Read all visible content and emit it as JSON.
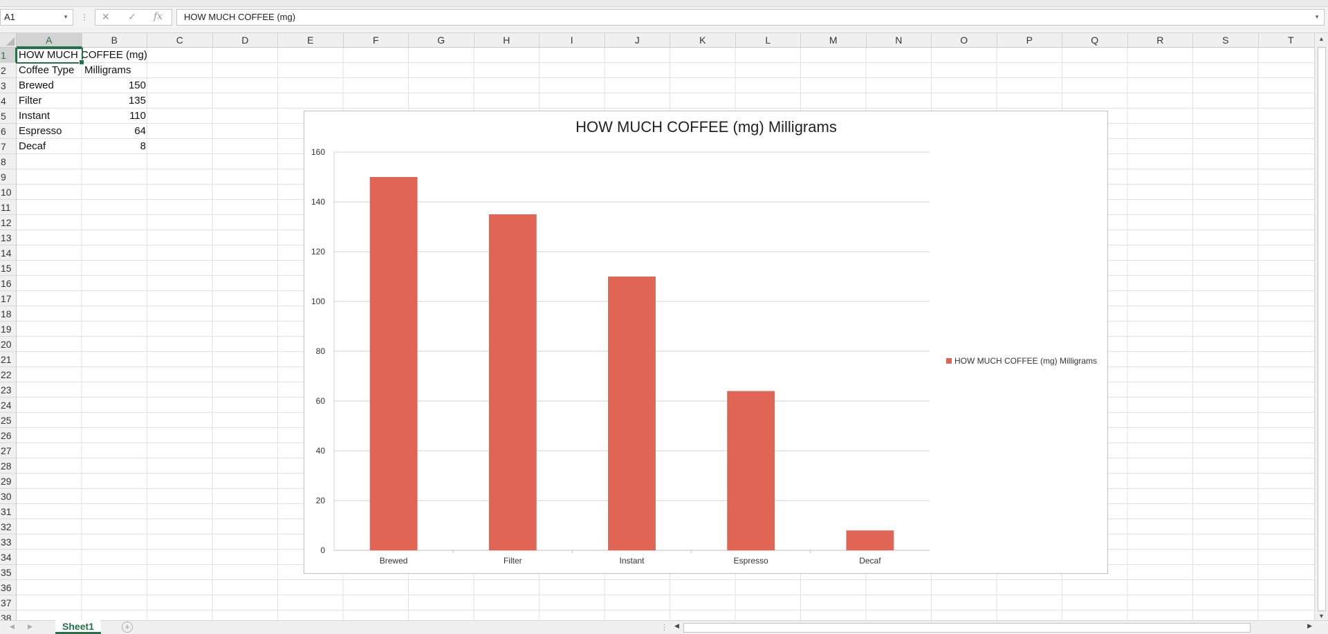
{
  "formula_bar": {
    "name_box": "A1",
    "cancel_icon": "✕",
    "enter_icon": "✓",
    "fx_label": "fx",
    "formula": "HOW MUCH COFFEE (mg)"
  },
  "columns": [
    "A",
    "B",
    "C",
    "D",
    "E",
    "F",
    "G",
    "H",
    "I",
    "J",
    "K",
    "L",
    "M",
    "N",
    "O",
    "P",
    "Q",
    "R",
    "S",
    "T"
  ],
  "rows": [
    "1",
    "2",
    "3",
    "4",
    "5",
    "6",
    "7",
    "8",
    "9",
    "10",
    "11",
    "12",
    "13",
    "14",
    "15",
    "16",
    "17",
    "18",
    "19",
    "20",
    "21",
    "22",
    "23",
    "24",
    "25",
    "26",
    "27",
    "28",
    "29",
    "30",
    "31",
    "32",
    "33",
    "34",
    "35",
    "36",
    "37",
    "38"
  ],
  "cells": {
    "a1": "HOW MUCH COFFEE (mg)",
    "a2": "Coffee Type",
    "b2": "Milligrams",
    "a3": "Brewed",
    "b3": "150",
    "a4": "Filter",
    "b4": "135",
    "a5": "Instant",
    "b5": "110",
    "a6": "Espresso",
    "b6": "64",
    "a7": "Decaf",
    "b7": "8"
  },
  "chart_data": {
    "type": "bar",
    "title": "HOW MUCH COFFEE (mg) Milligrams",
    "categories": [
      "Brewed",
      "Filter",
      "Instant",
      "Espresso",
      "Decaf"
    ],
    "series": [
      {
        "name": "HOW MUCH COFFEE (mg) Milligrams",
        "values": [
          150,
          135,
          110,
          64,
          8
        ],
        "color": "#E06555"
      }
    ],
    "ylim": [
      0,
      160
    ],
    "yticks": [
      0,
      20,
      40,
      60,
      80,
      100,
      120,
      140,
      160
    ],
    "grid": true,
    "legend": "right"
  },
  "sheet_tabs": {
    "active": "Sheet1",
    "add_icon": "+"
  },
  "colors": {
    "accent": "#217346",
    "bar": "#E06555"
  }
}
